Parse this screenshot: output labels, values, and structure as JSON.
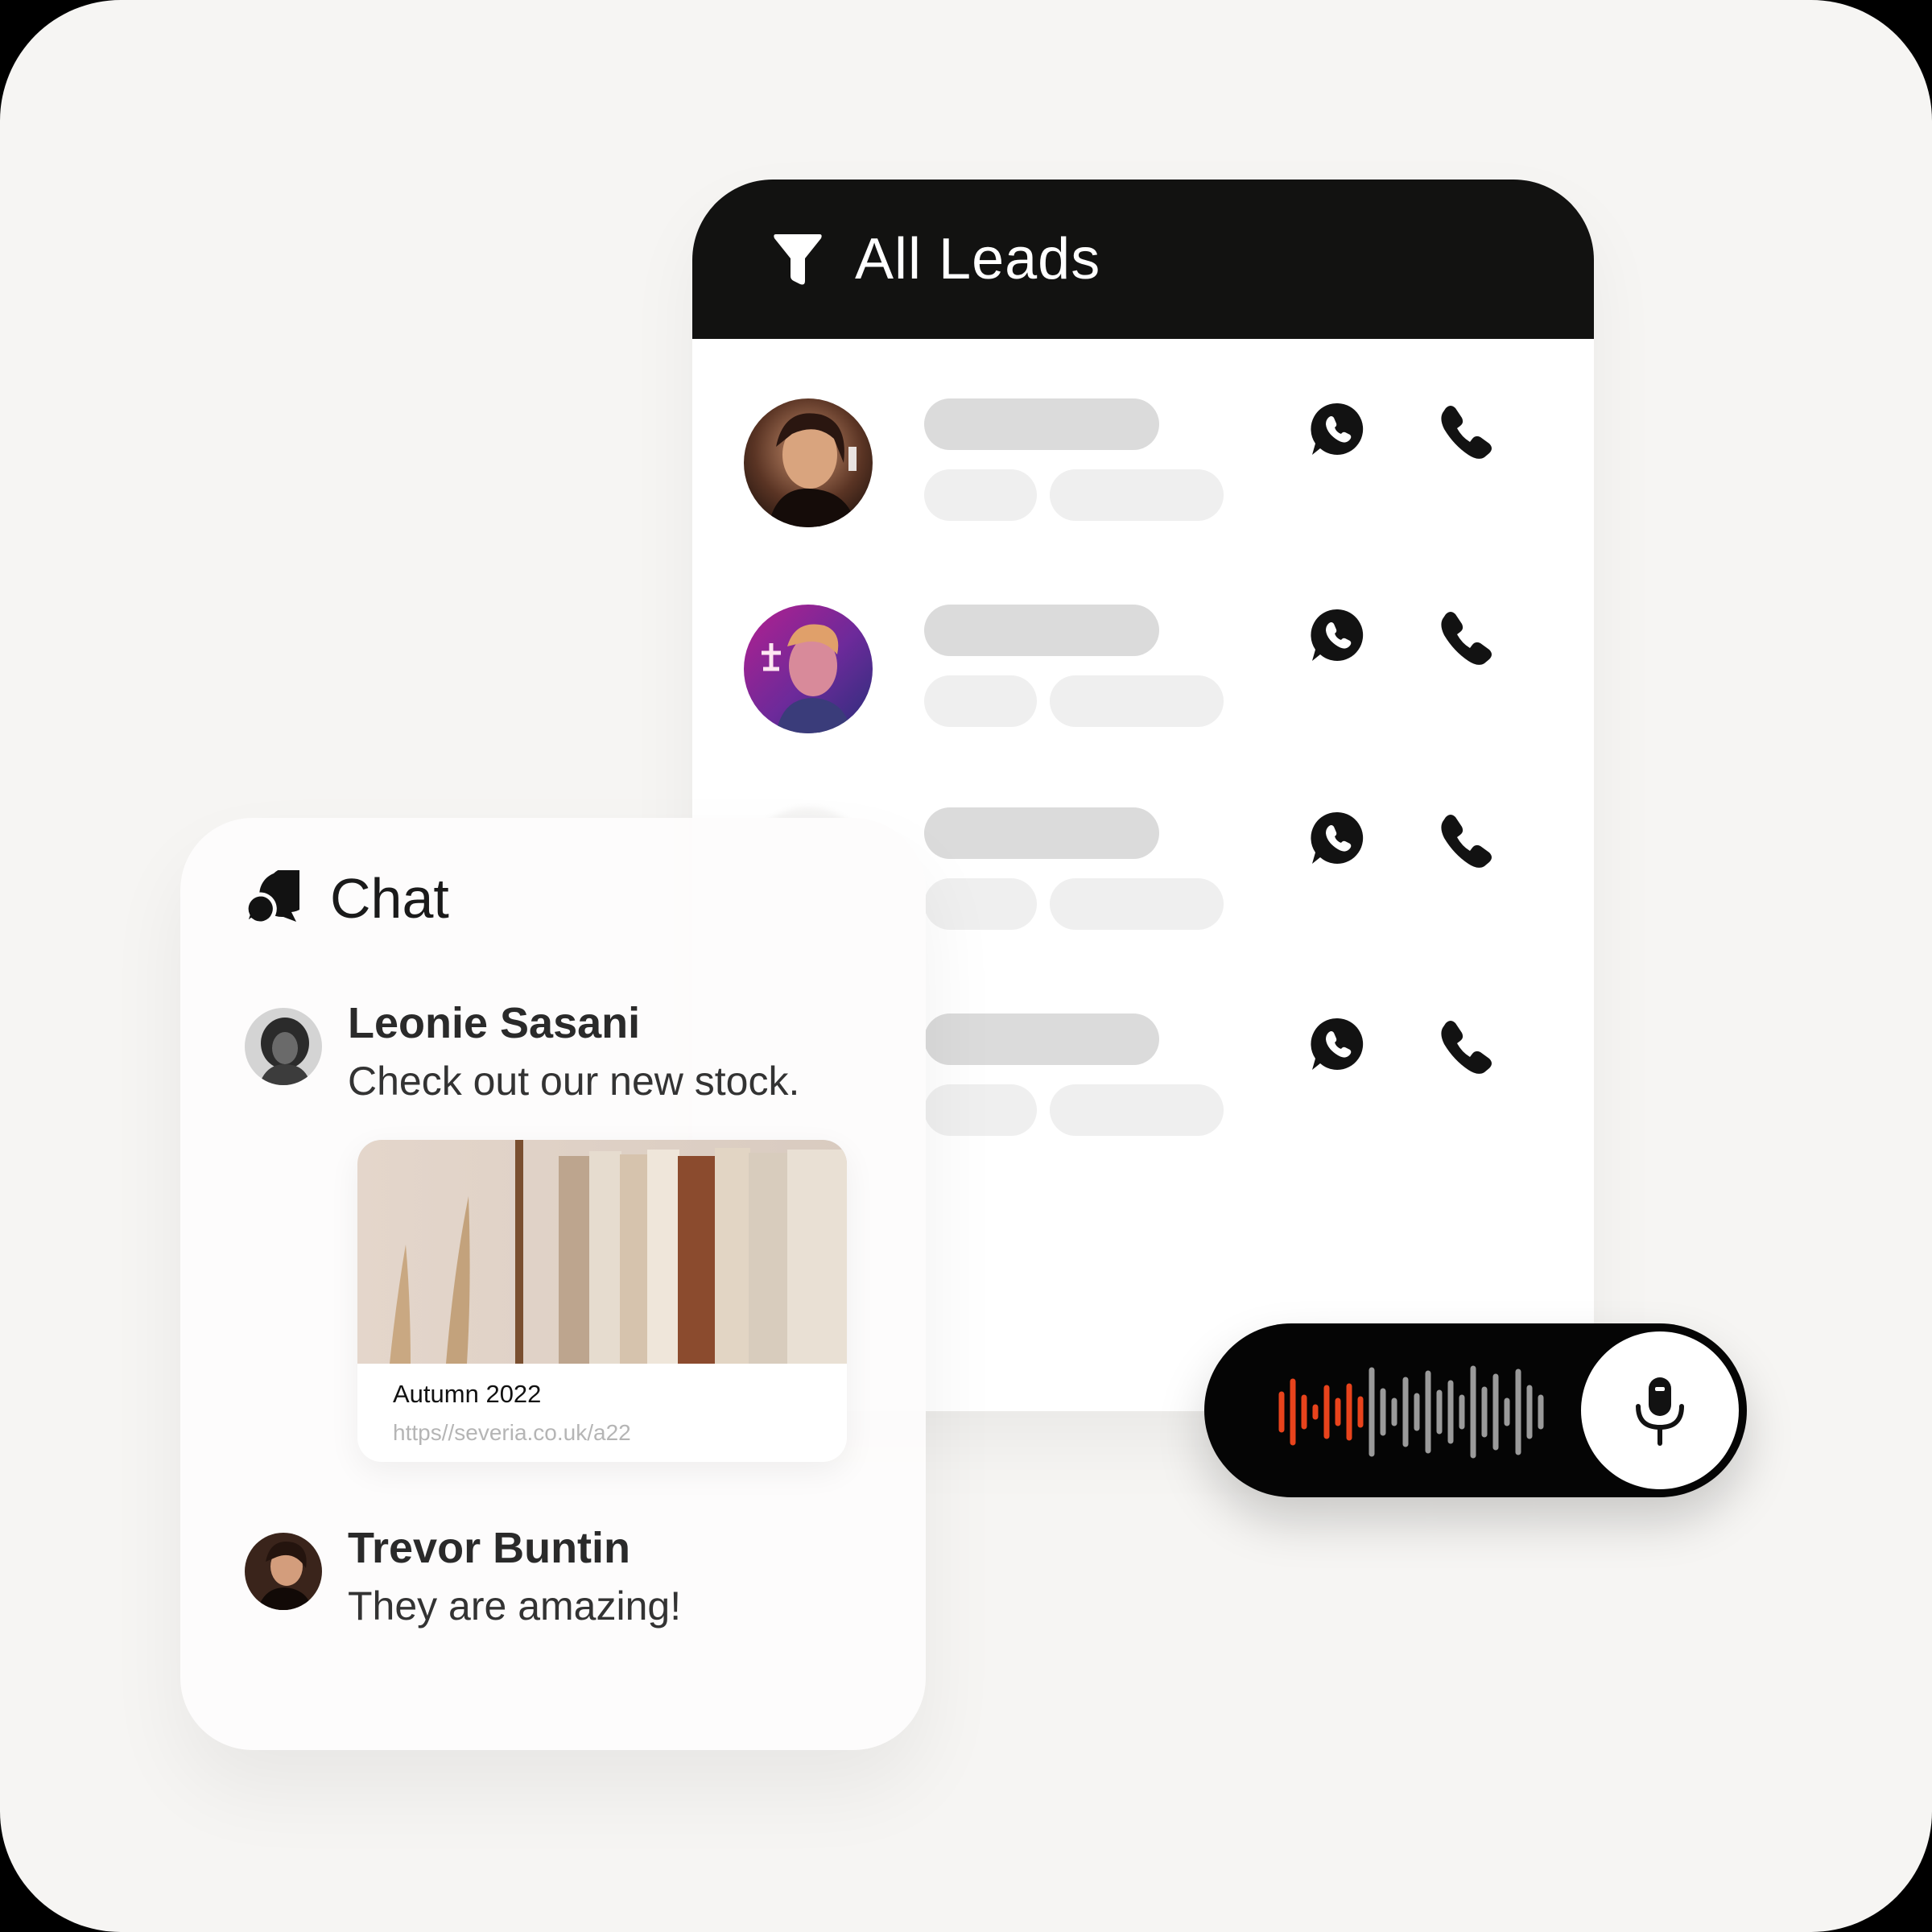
{
  "leads": {
    "title": "All Leads",
    "rows": [
      {
        "avatar": "woman-portrait-warm",
        "actions": [
          "whatsapp-icon",
          "phone-icon"
        ]
      },
      {
        "avatar": "person-portrait-neon",
        "actions": [
          "whatsapp-icon",
          "phone-icon"
        ]
      },
      {
        "avatar": "placeholder",
        "actions": [
          "whatsapp-icon",
          "phone-icon"
        ]
      },
      {
        "avatar": "placeholder",
        "actions": [
          "whatsapp-icon",
          "phone-icon"
        ]
      }
    ]
  },
  "chat": {
    "title": "Chat",
    "messages": [
      {
        "name": "Leonie Sasani",
        "text": "Check out our new stock."
      },
      {
        "name": "Trevor Buntin",
        "text": "They are amazing!"
      }
    ],
    "link_preview": {
      "title": "Autumn 2022",
      "url": "https//severia.co.uk/a22"
    }
  },
  "voice": {
    "icon": "microphone-icon",
    "accent_color": "#e8431c",
    "wave_color": "#9a9a9a"
  },
  "colors": {
    "background": "#f6f5f3",
    "header": "#121211",
    "skeleton_dark": "#dbdbdb",
    "skeleton_light": "#efefef"
  }
}
